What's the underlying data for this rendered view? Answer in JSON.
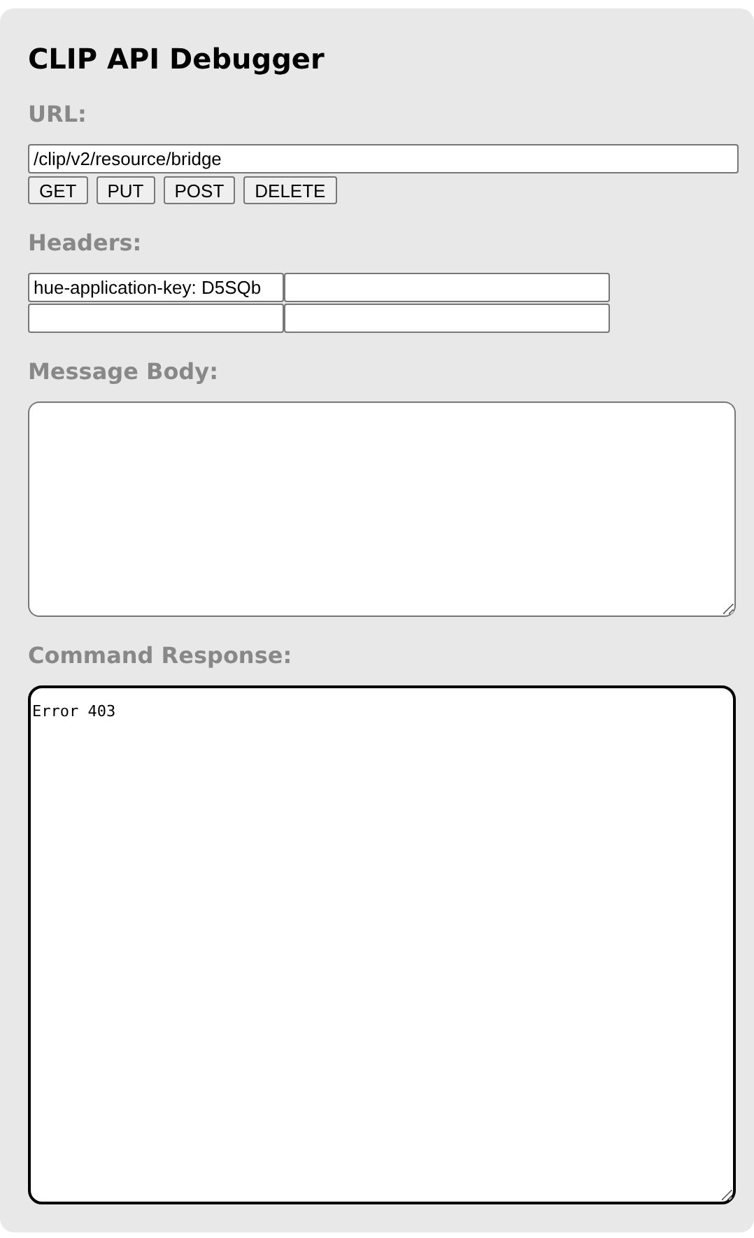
{
  "title": "CLIP API Debugger",
  "url": {
    "label": "URL:",
    "value": "/clip/v2/resource/bridge",
    "buttons": [
      "GET",
      "PUT",
      "POST",
      "DELETE"
    ]
  },
  "headers": {
    "label": "Headers:",
    "fields": [
      {
        "value": "hue-application-key: D5SQb"
      }
    ]
  },
  "message_body": {
    "label": "Message Body:"
  },
  "command_response": {
    "label": "Command Response:",
    "value": "Error 403"
  }
}
